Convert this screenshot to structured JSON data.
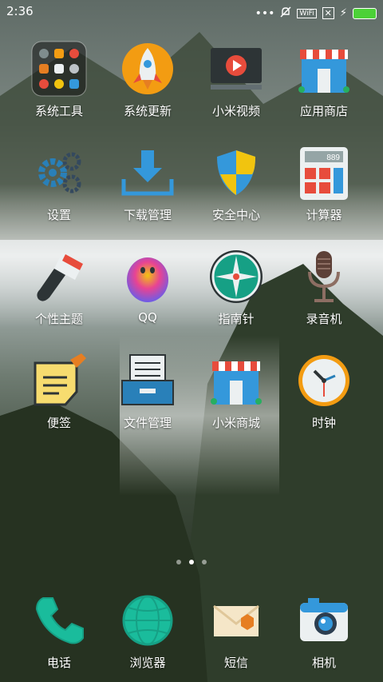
{
  "status_bar": {
    "time": "2:36",
    "wifi_label": "WiFi"
  },
  "apps": [
    {
      "label": "系统工具"
    },
    {
      "label": "系统更新"
    },
    {
      "label": "小米视频"
    },
    {
      "label": "应用商店"
    },
    {
      "label": "设置"
    },
    {
      "label": "下载管理"
    },
    {
      "label": "安全中心"
    },
    {
      "label": "计算器"
    },
    {
      "label": "个性主题"
    },
    {
      "label": "QQ"
    },
    {
      "label": "指南针"
    },
    {
      "label": "录音机"
    },
    {
      "label": "便签"
    },
    {
      "label": "文件管理"
    },
    {
      "label": "小米商城"
    },
    {
      "label": "时钟"
    }
  ],
  "calculator_display": "889",
  "dock": [
    {
      "label": "电话"
    },
    {
      "label": "浏览器"
    },
    {
      "label": "短信"
    },
    {
      "label": "相机"
    }
  ]
}
